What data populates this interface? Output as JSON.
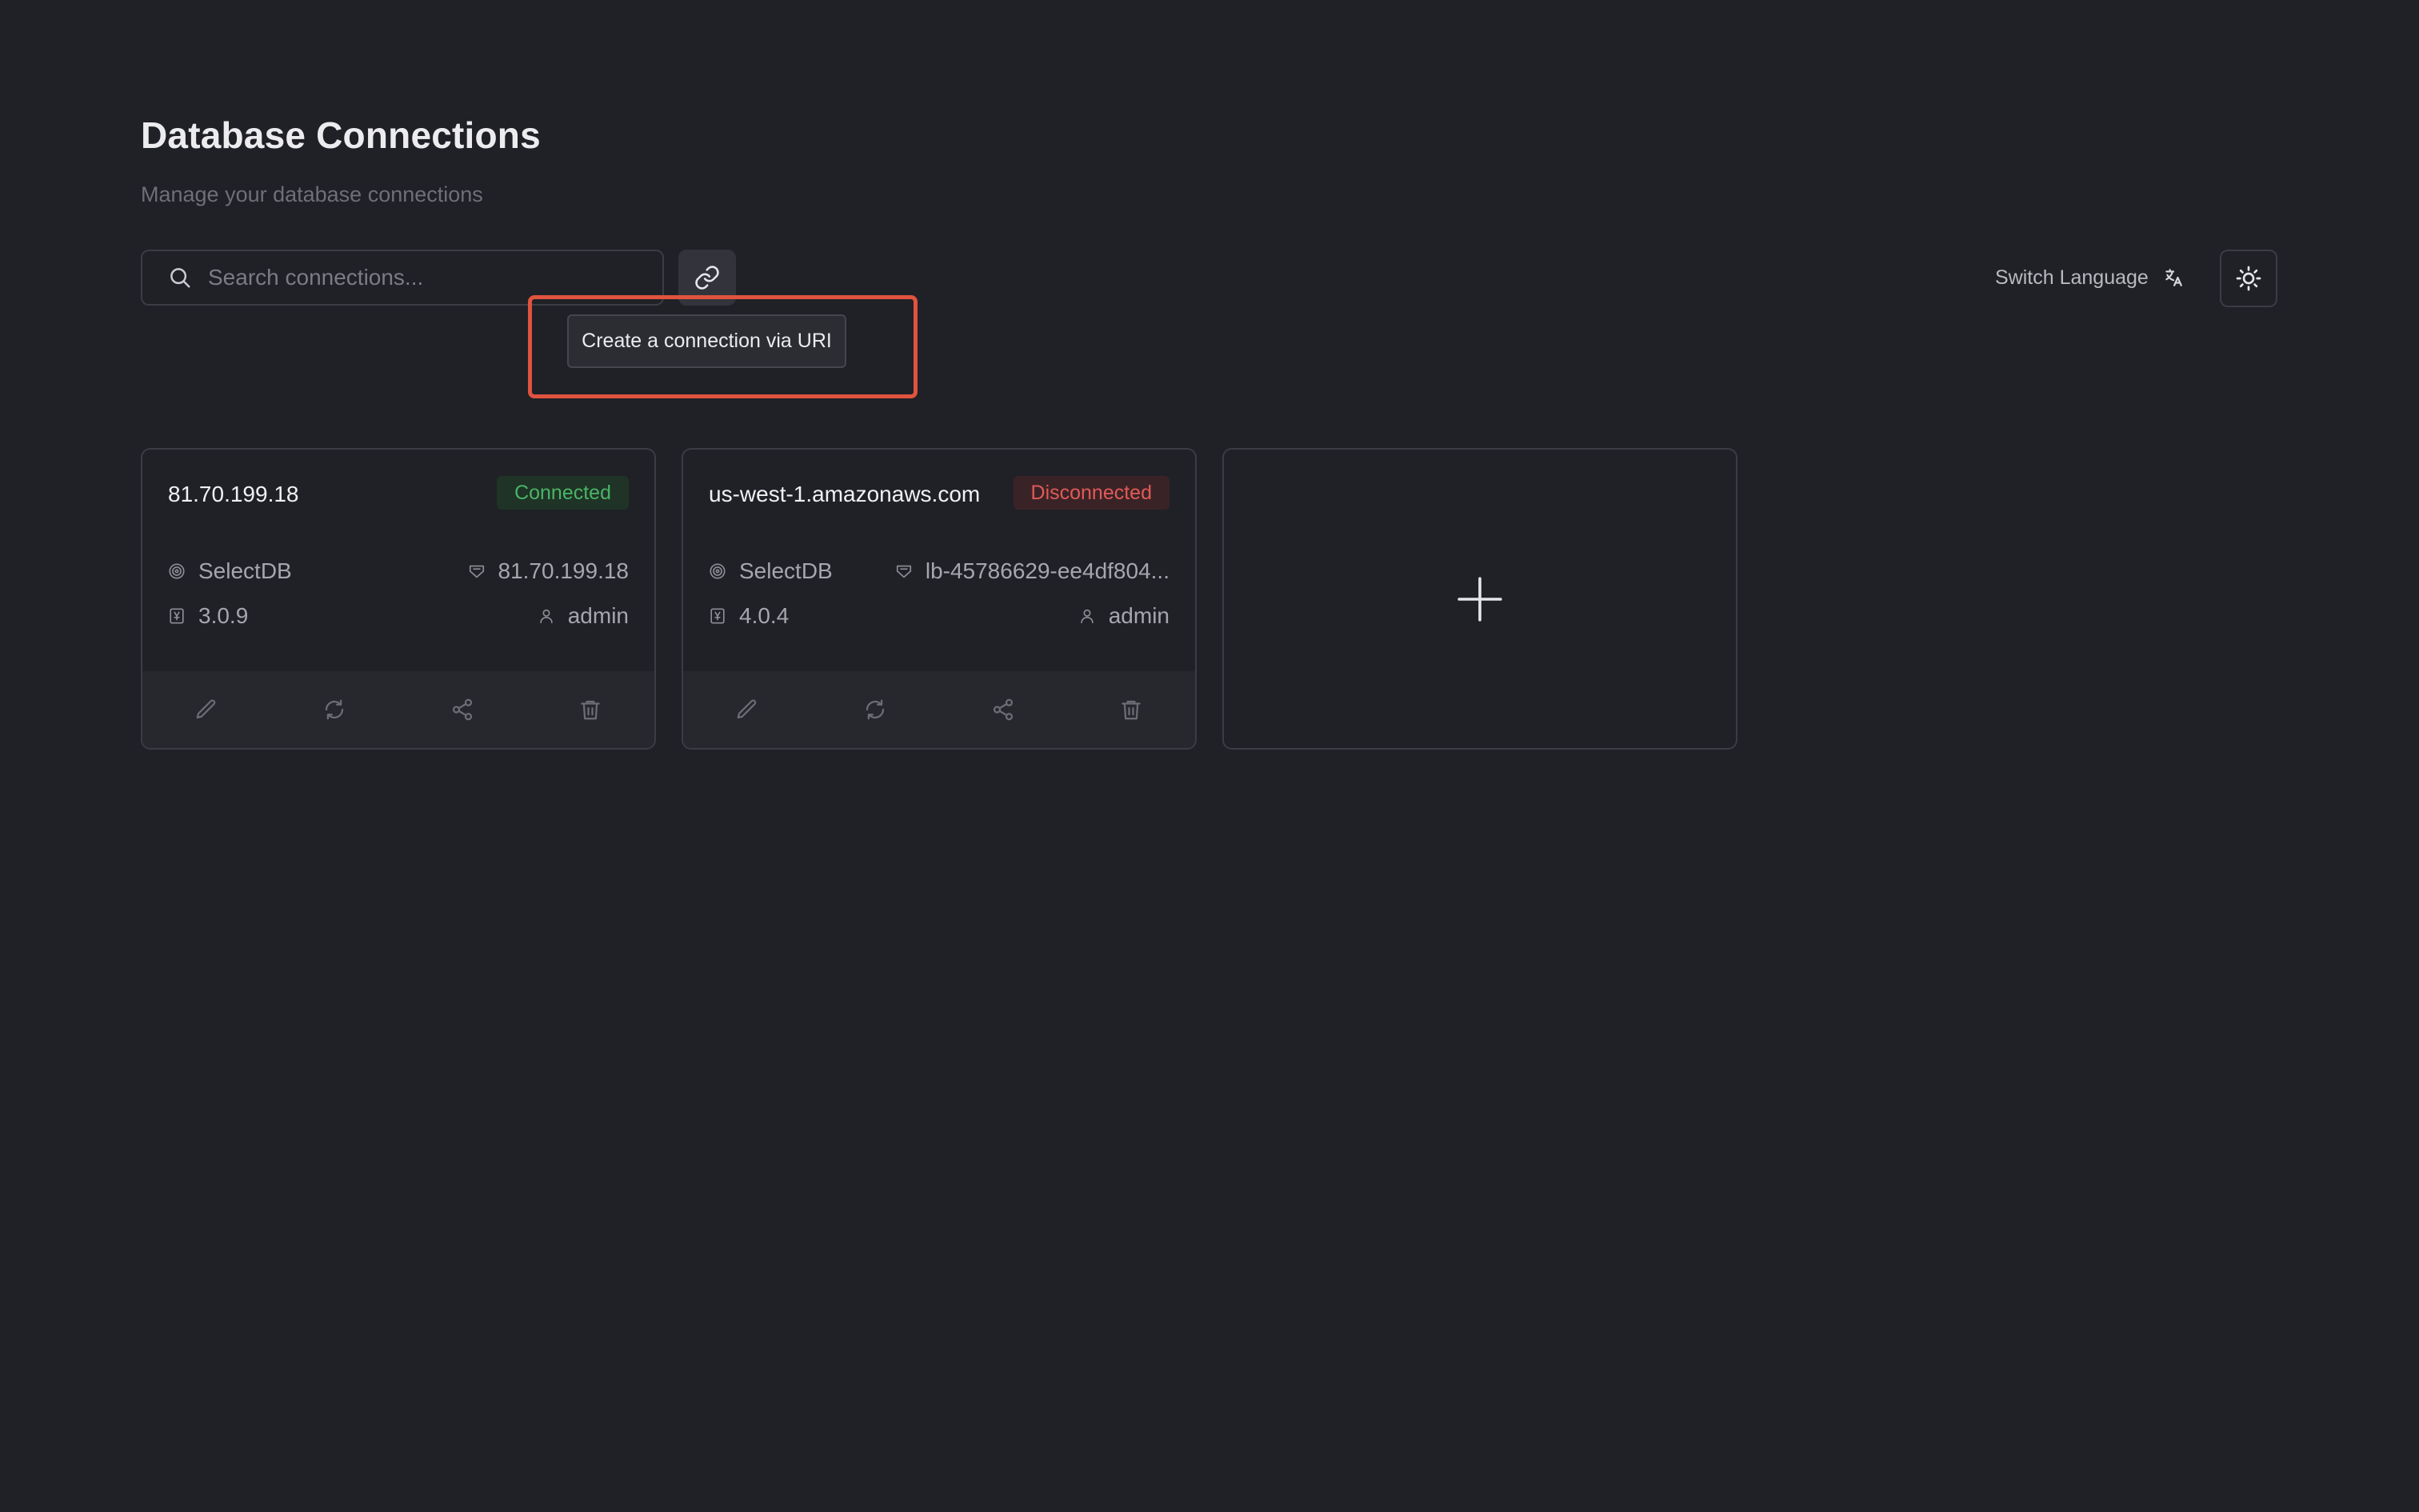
{
  "header": {
    "title": "Database Connections",
    "subtitle": "Manage your database connections"
  },
  "search": {
    "placeholder": "Search connections..."
  },
  "toolbar": {
    "uri_tooltip": "Create a connection via URI",
    "switch_language_label": "Switch Language"
  },
  "connections": [
    {
      "name": "81.70.199.18",
      "status": "Connected",
      "db_type": "SelectDB",
      "host": "81.70.199.18",
      "version": "3.0.9",
      "user": "admin"
    },
    {
      "name": "us-west-1.amazonaws.com",
      "status": "Disconnected",
      "db_type": "SelectDB",
      "host": "lb-45786629-ee4df804...",
      "version": "4.0.4",
      "user": "admin"
    }
  ],
  "colors": {
    "background": "#202127",
    "connected": "#4ab466",
    "disconnected": "#e05a58",
    "highlight": "#e0533e"
  },
  "icons": [
    "search-icon",
    "link-icon",
    "translate-icon",
    "sun-icon",
    "database-icon",
    "server-icon",
    "version-icon",
    "user-icon",
    "edit-icon",
    "refresh-icon",
    "share-icon",
    "trash-icon",
    "plus-icon"
  ]
}
